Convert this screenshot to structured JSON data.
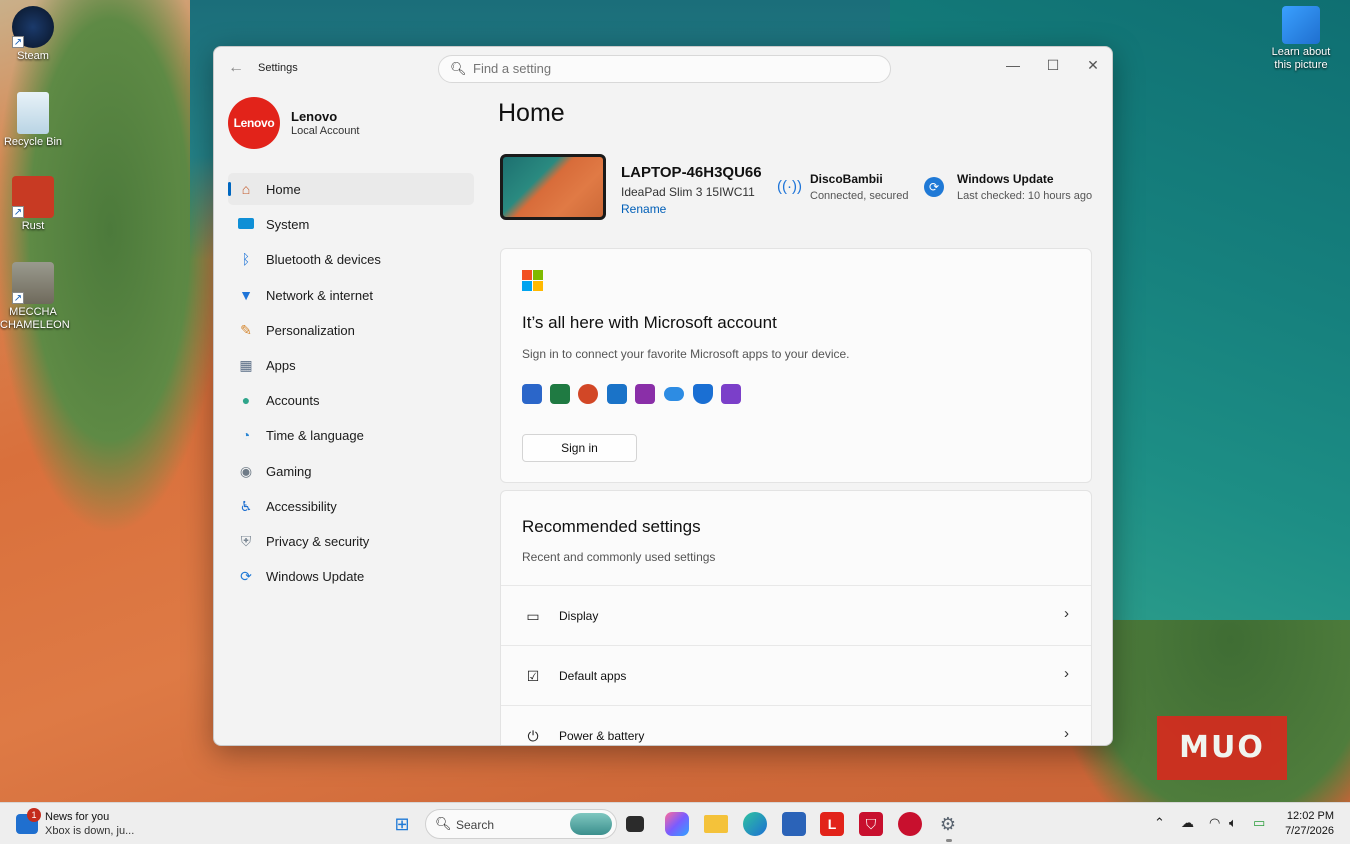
{
  "desktop": {
    "icons": [
      {
        "label": "Steam"
      },
      {
        "label": "Recycle Bin"
      },
      {
        "label": "Rust"
      },
      {
        "label": "MECCHA CHAMELEON"
      }
    ],
    "spotlight_label": "Learn about this picture"
  },
  "settings": {
    "app_title": "Settings",
    "search_placeholder": "Find a setting",
    "profile": {
      "avatar_text": "Lenovo",
      "name": "Lenovo",
      "account_type": "Local Account"
    },
    "nav": [
      {
        "label": "Home",
        "icon": "home-icon",
        "color": "#c45a2a",
        "active": true
      },
      {
        "label": "System",
        "icon": "monitor-icon",
        "color": "#0f8fd6"
      },
      {
        "label": "Bluetooth & devices",
        "icon": "bluetooth-icon",
        "color": "#1e74d8"
      },
      {
        "label": "Network & internet",
        "icon": "wifi-icon",
        "color": "#1e74d8"
      },
      {
        "label": "Personalization",
        "icon": "brush-icon",
        "color": "#d4862e"
      },
      {
        "label": "Apps",
        "icon": "apps-icon",
        "color": "#5a6d86"
      },
      {
        "label": "Accounts",
        "icon": "person-icon",
        "color": "#2fa58b"
      },
      {
        "label": "Time & language",
        "icon": "globe-clock-icon",
        "color": "#2a86d3"
      },
      {
        "label": "Gaming",
        "icon": "gamepad-icon",
        "color": "#6f7b87"
      },
      {
        "label": "Accessibility",
        "icon": "accessibility-icon",
        "color": "#1f6fcf"
      },
      {
        "label": "Privacy & security",
        "icon": "shield-icon",
        "color": "#7b8793"
      },
      {
        "label": "Windows Update",
        "icon": "update-icon",
        "color": "#1f79d6"
      }
    ],
    "home": {
      "title": "Home",
      "device": {
        "name": "LAPTOP-46H3QU66",
        "model": "IdeaPad Slim 3 15IWC11",
        "rename": "Rename"
      },
      "network": {
        "name": "DiscoBambii",
        "status": "Connected, secured"
      },
      "update": {
        "title": "Windows Update",
        "status": "Last checked: 10 hours ago"
      },
      "ms_account": {
        "heading": "It’s all here with Microsoft account",
        "description": "Sign in to connect your favorite Microsoft apps to your device.",
        "sign_in": "Sign in",
        "apps": [
          {
            "icon": "word-icon",
            "color": "#2b66c9"
          },
          {
            "icon": "excel-icon",
            "color": "#1f7a42"
          },
          {
            "icon": "powerpoint-icon",
            "color": "#d24726"
          },
          {
            "icon": "outlook-icon",
            "color": "#1a73c8"
          },
          {
            "icon": "onenote-icon",
            "color": "#8a2fa8"
          },
          {
            "icon": "onedrive-icon",
            "color": "#2d8ce3"
          },
          {
            "icon": "defender-icon",
            "color": "#1a6fd3"
          },
          {
            "icon": "clipchamp-icon",
            "color": "#7b3fc9"
          }
        ]
      },
      "recommended": {
        "heading": "Recommended settings",
        "description": "Recent and commonly used settings",
        "items": [
          {
            "label": "Display",
            "icon": "laptop-icon"
          },
          {
            "label": "Default apps",
            "icon": "default-apps-icon"
          },
          {
            "label": "Power & battery",
            "icon": "power-icon"
          }
        ]
      }
    }
  },
  "watermark": "MUO",
  "taskbar": {
    "news": {
      "title": "News for you",
      "subtitle": "Xbox is down, ju...",
      "badge": "1"
    },
    "search_label": "Search",
    "time": "12:02 PM",
    "date": "7/27/2026"
  }
}
